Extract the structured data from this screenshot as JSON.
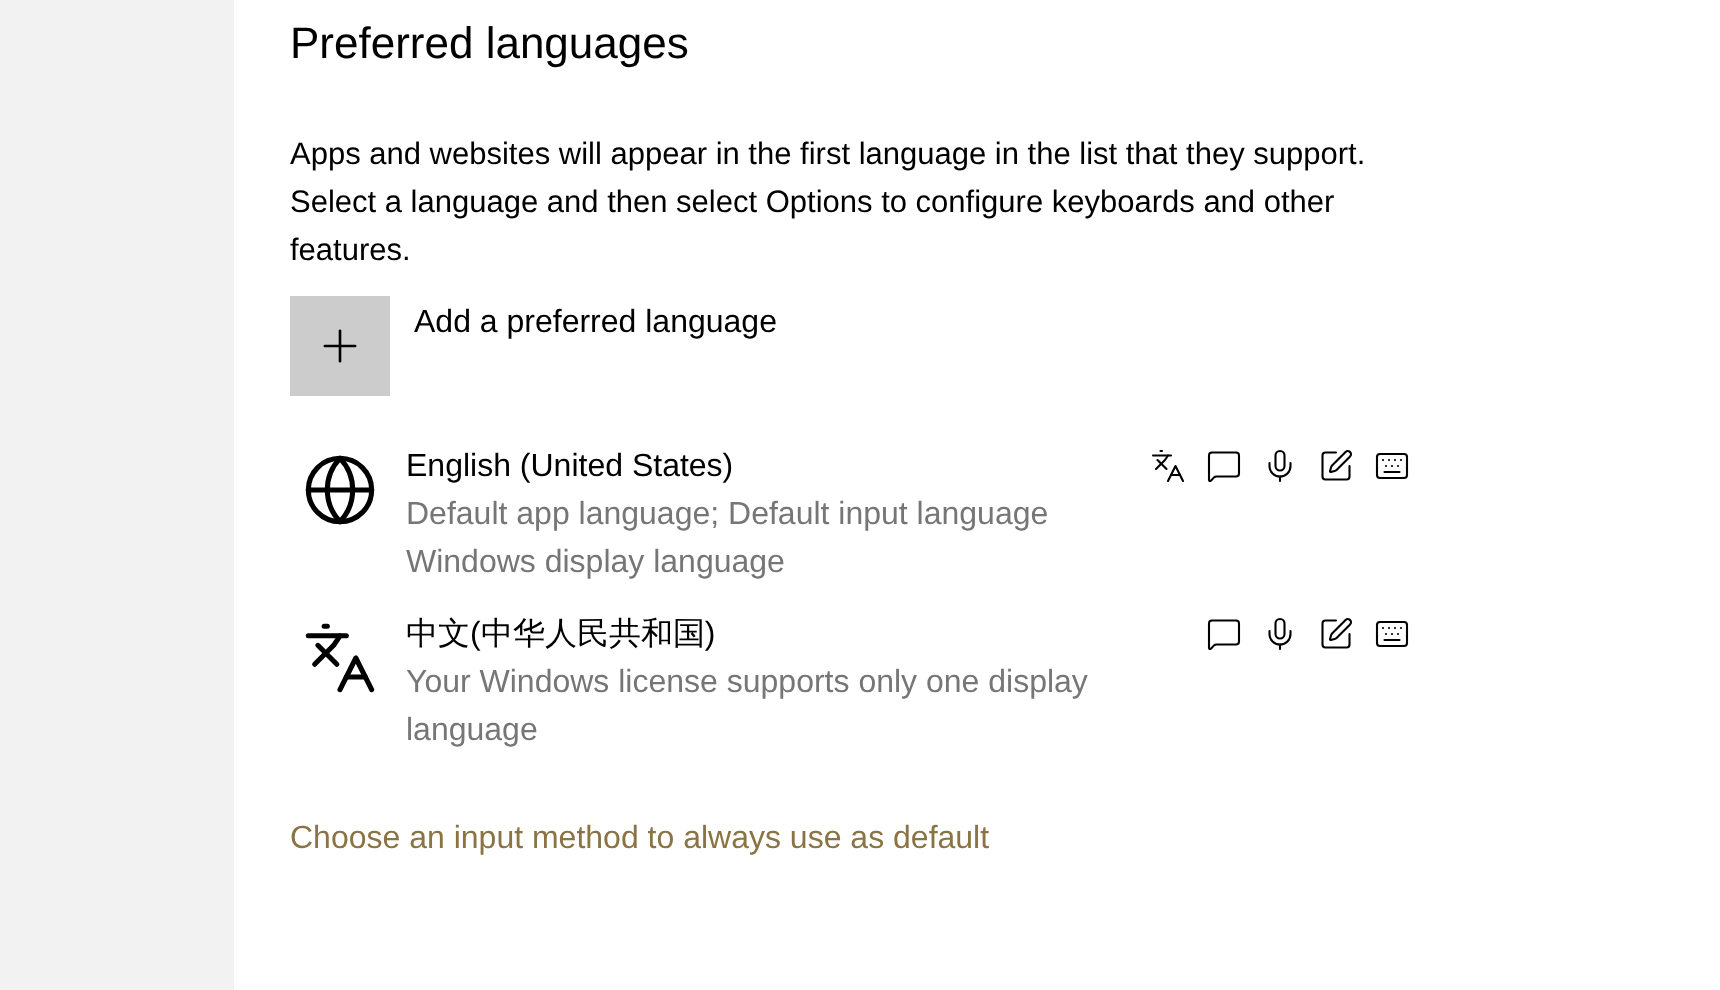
{
  "title": "Preferred languages",
  "description": "Apps and websites will appear in the first language in the list that they support. Select a language and then select Options to configure keyboards and other features.",
  "add_button": {
    "label": "Add a preferred language"
  },
  "languages": [
    {
      "name": "English (United States)",
      "details": [
        "Default app language; Default input language",
        "Windows display language"
      ],
      "features": [
        {
          "kind": "display-language"
        },
        {
          "kind": "speech"
        },
        {
          "kind": "microphone"
        },
        {
          "kind": "handwriting"
        },
        {
          "kind": "keyboard"
        }
      ]
    },
    {
      "name": "中文(中华人民共和国)",
      "details": [
        "Your Windows license supports only one display language"
      ],
      "features": [
        {
          "kind": "speech"
        },
        {
          "kind": "microphone"
        },
        {
          "kind": "handwriting"
        },
        {
          "kind": "keyboard"
        }
      ]
    }
  ],
  "link": "Choose an input method to always use as default"
}
